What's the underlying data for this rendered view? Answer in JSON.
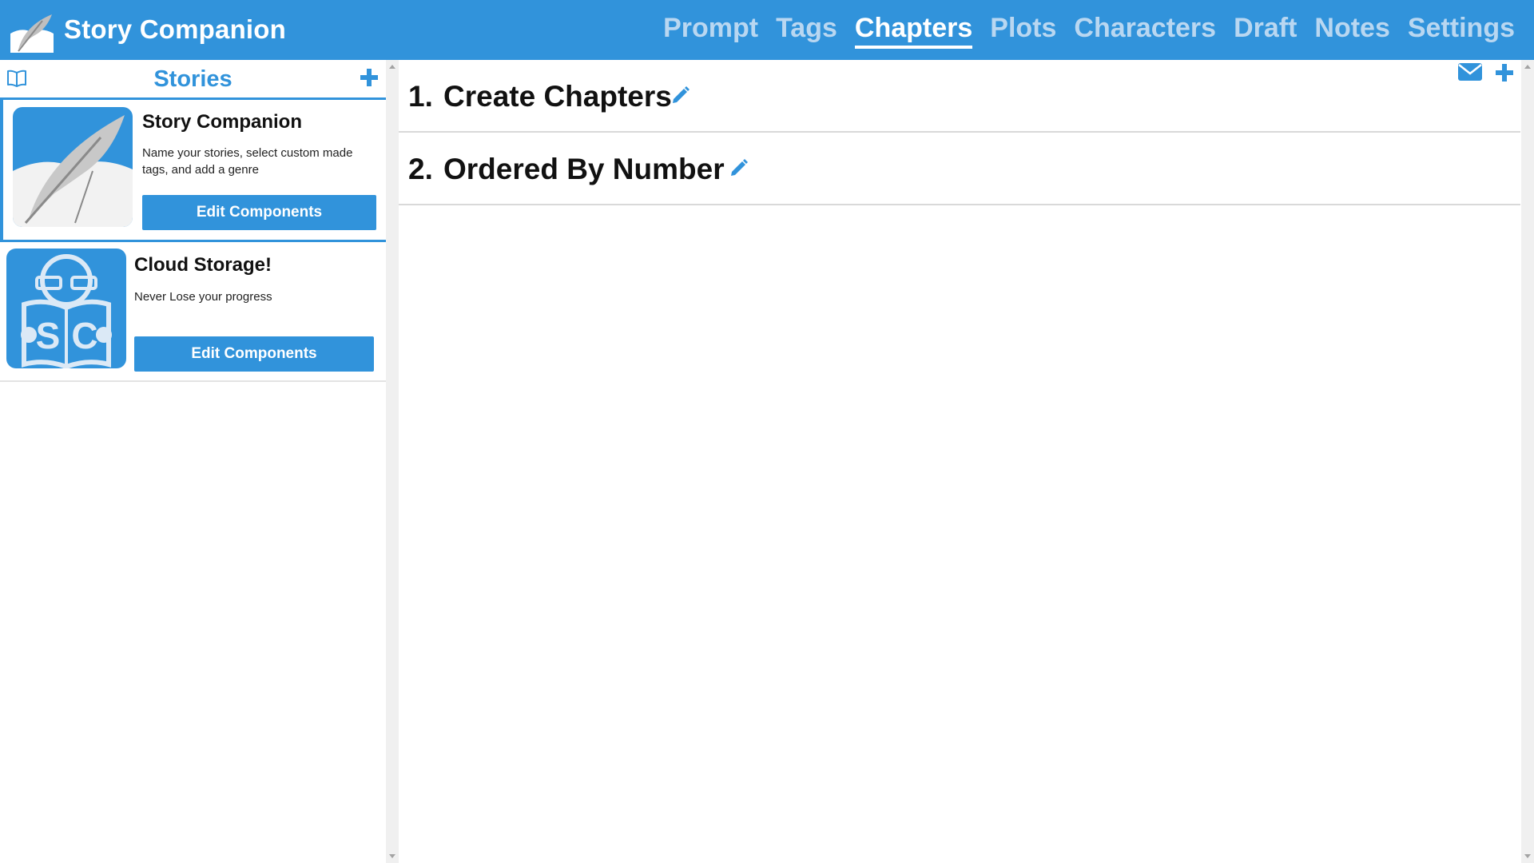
{
  "app": {
    "title": "Story Companion"
  },
  "nav": {
    "items": [
      {
        "label": "Prompt",
        "active": false
      },
      {
        "label": "Tags",
        "active": false
      },
      {
        "label": "Chapters",
        "active": true
      },
      {
        "label": "Plots",
        "active": false
      },
      {
        "label": "Characters",
        "active": false
      },
      {
        "label": "Draft",
        "active": false
      },
      {
        "label": "Notes",
        "active": false
      },
      {
        "label": "Settings",
        "active": false
      }
    ]
  },
  "sidebar": {
    "title": "Stories",
    "stories": [
      {
        "title": "Story Companion",
        "description": "Name your stories, select custom made tags, and add a genre",
        "button_label": "Edit Components",
        "thumbnail": "quill-feather-icon",
        "selected": true
      },
      {
        "title": "Cloud Storage!",
        "description": "Never Lose your progress",
        "button_label": "Edit Components",
        "thumbnail": "sc-reader-icon",
        "selected": false
      }
    ]
  },
  "main": {
    "chapters": [
      {
        "number": "1.",
        "title": "Create Chapters"
      },
      {
        "number": "2.",
        "title": "Ordered By Number"
      }
    ]
  },
  "colors": {
    "accent": "#3193db",
    "nav_inactive": "#b9d7f1"
  },
  "icons": [
    "quill-feather-icon",
    "book-icon",
    "plus-icon",
    "mail-icon",
    "pencil-icon",
    "sc-reader-icon"
  ]
}
